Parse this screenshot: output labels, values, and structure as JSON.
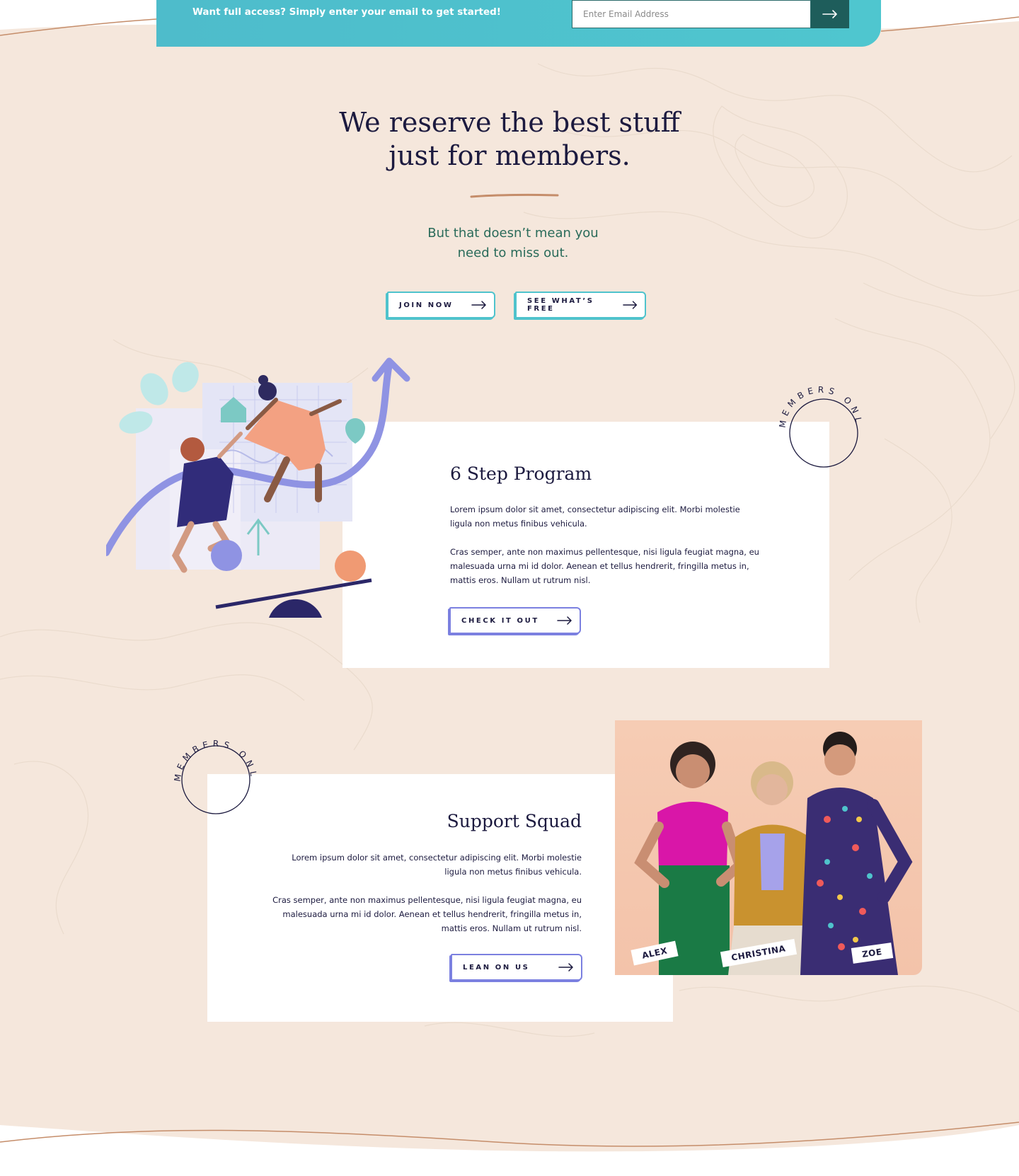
{
  "colors": {
    "background": "#f5e7dc",
    "banner": "#4fc3cc",
    "accent_teal": "#4fc3cc",
    "accent_purple": "#7b80e0",
    "navy": "#1c1a3f",
    "green_text": "#2a6b5a",
    "copper_line": "#c58d6a"
  },
  "banner": {
    "text": "Want full access? Simply enter your email to get started!",
    "email_placeholder": "Enter Email Address",
    "submit_icon": "arrow-right-icon"
  },
  "hero": {
    "title_line1": "We reserve the best stuff",
    "title_line2": "just for members.",
    "sub_line1": "But that doesn’t mean you",
    "sub_line2": "need to miss out.",
    "buttons": [
      {
        "label": "JOIN NOW",
        "icon": "arrow-right-icon"
      },
      {
        "label": "SEE WHAT’S FREE",
        "icon": "arrow-right-icon"
      }
    ]
  },
  "stamp_text": "MEMBERS ONLY",
  "program": {
    "title": "6 Step Program",
    "para1": "Lorem ipsum dolor sit amet, consectetur adipiscing elit. Morbi molestie ligula non metus finibus vehicula.",
    "para2": "Cras semper, ante non maximus pellentesque, nisi ligula feugiat magna, eu malesuada urna mi id dolor. Aenean et tellus hendrerit, fringilla metus in, mattis eros. Nullam ut rutrum nisl.",
    "button": "CHECK IT OUT"
  },
  "squad": {
    "title": "Support Squad",
    "para1": "Lorem ipsum dolor sit amet, consectetur adipiscing elit. Morbi molestie ligula non metus finibus vehicula.",
    "para2": "Cras semper, ante non maximus pellentesque, nisi ligula feugiat magna, eu malesuada urna mi id dolor. Aenean et tellus hendrerit, fringilla metus in, mattis eros. Nullam ut rutrum nisl.",
    "button": "LEAN ON US",
    "names": [
      "ALEX",
      "CHRISTINA",
      "ZOE"
    ]
  }
}
